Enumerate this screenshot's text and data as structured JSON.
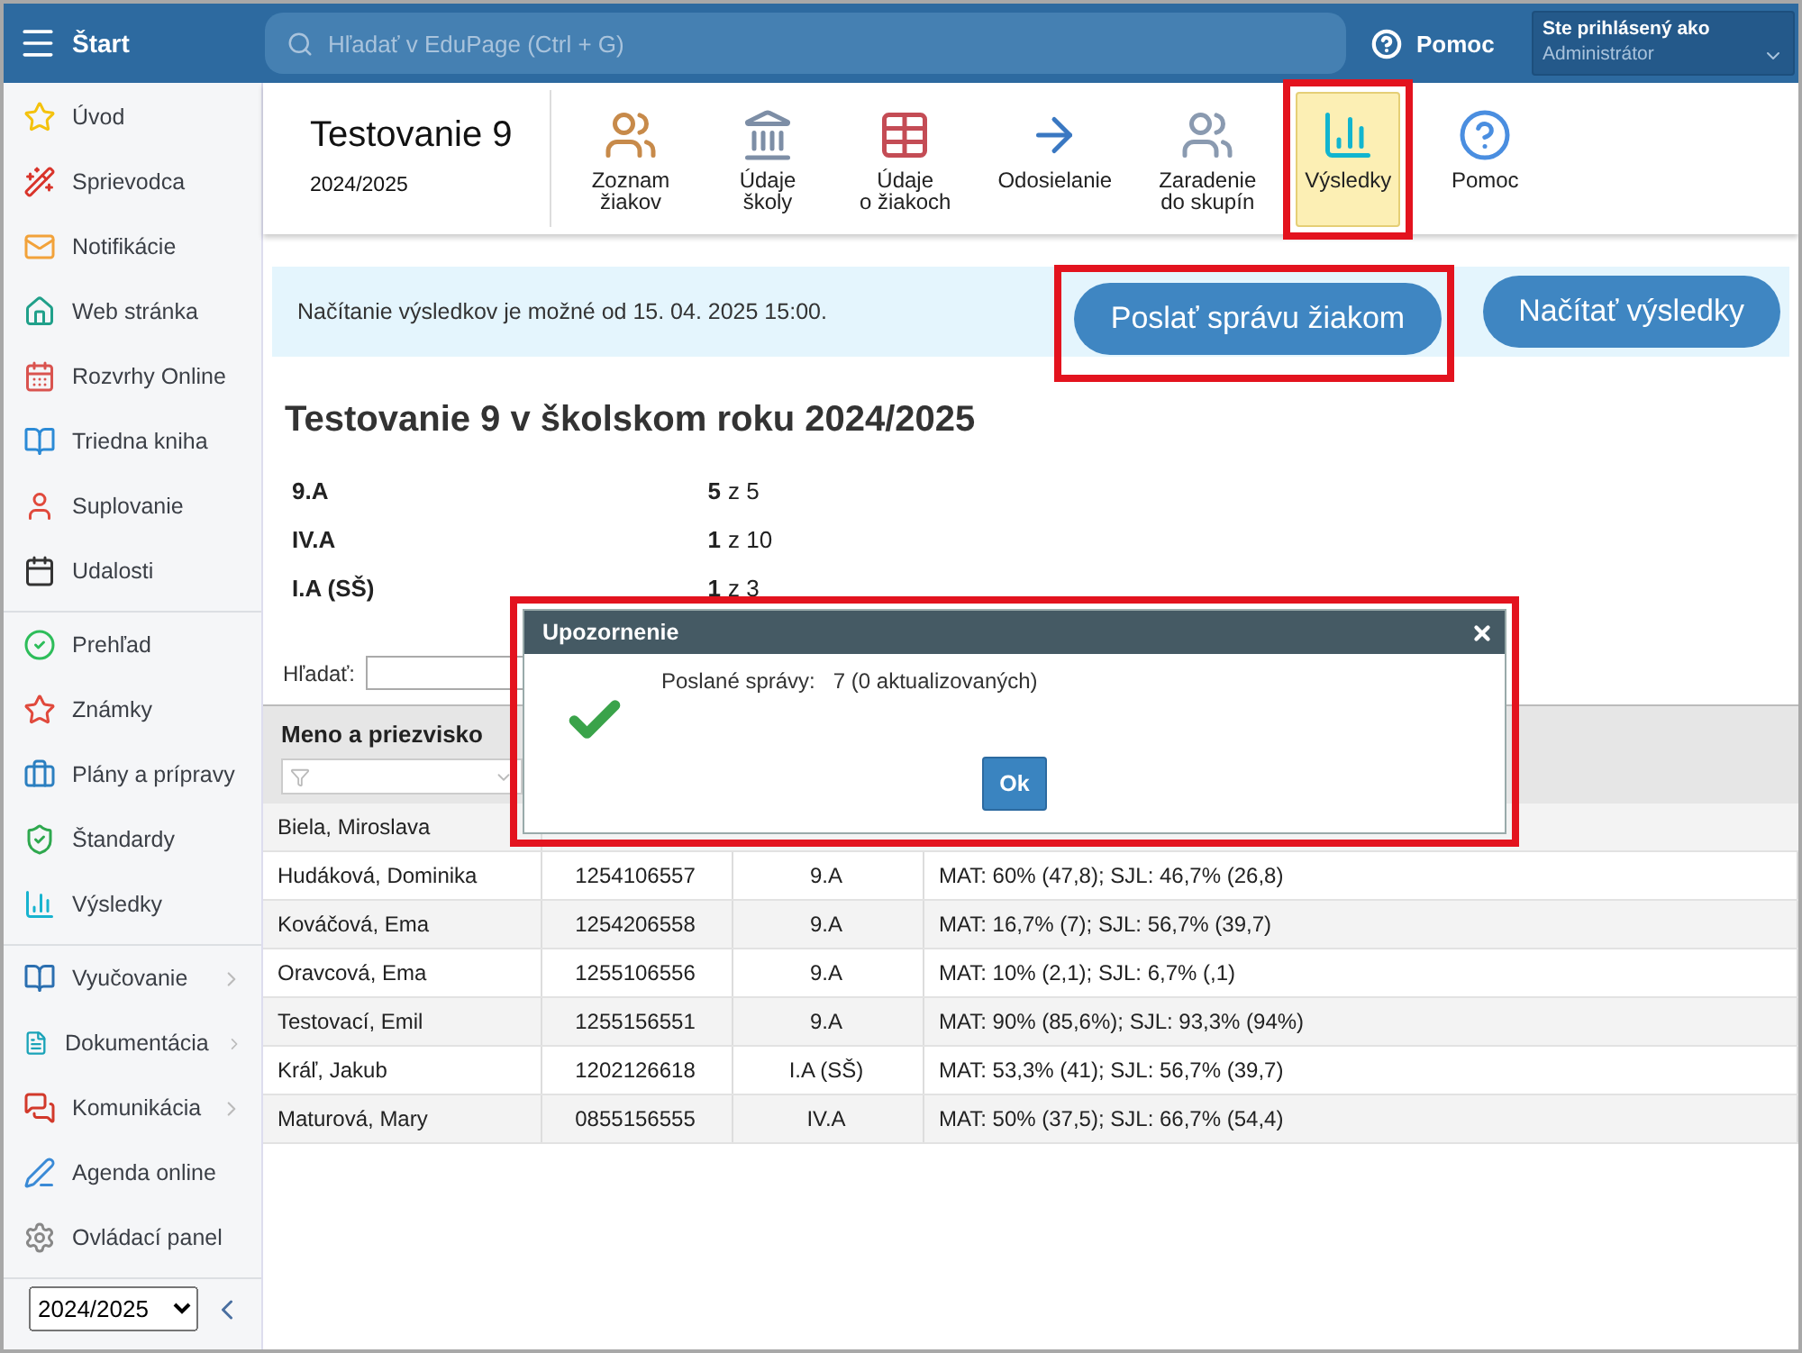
{
  "top_bar": {
    "menu_label": "Štart",
    "search": {
      "placeholder": "Hľadať v EduPage (Ctrl + G)"
    },
    "help": "Pomoc",
    "user": {
      "caption": "Ste prihlásený ako",
      "role": "Administrátor"
    }
  },
  "sidebar": {
    "groups": [
      [
        {
          "label": "Úvod",
          "kind": "star",
          "submenu": false
        },
        {
          "label": "Sprievodca",
          "kind": "wand",
          "submenu": false
        },
        {
          "label": "Notifikácie",
          "kind": "mail",
          "submenu": false
        },
        {
          "label": "Web stránka",
          "kind": "home",
          "submenu": false
        },
        {
          "label": "Rozvrhy Online",
          "kind": "grid",
          "submenu": false
        },
        {
          "label": "Triedna kniha",
          "kind": "book",
          "submenu": false
        },
        {
          "label": "Suplovanie",
          "kind": "person",
          "submenu": false
        },
        {
          "label": "Udalosti",
          "kind": "calendar",
          "submenu": false
        }
      ],
      [
        {
          "label": "Prehľad",
          "kind": "check",
          "submenu": false
        },
        {
          "label": "Známky",
          "kind": "grade",
          "submenu": false
        },
        {
          "label": "Plány a prípravy",
          "kind": "briefcase",
          "submenu": false
        },
        {
          "label": "Štandardy",
          "kind": "shield",
          "submenu": false
        },
        {
          "label": "Výsledky",
          "kind": "bars",
          "submenu": false
        }
      ],
      [
        {
          "label": "Vyučovanie",
          "kind": "openbook",
          "submenu": true
        },
        {
          "label": "Dokumentácia",
          "kind": "document",
          "submenu": true
        },
        {
          "label": "Komunikácia",
          "kind": "chat",
          "submenu": true
        },
        {
          "label": "Agenda online",
          "kind": "pen",
          "submenu": false
        },
        {
          "label": "Ovládací panel",
          "kind": "gear",
          "submenu": false
        }
      ]
    ],
    "year_select": "2024/2025"
  },
  "header": {
    "title": "Testovanie 9",
    "year": "2024/2025"
  },
  "tools": [
    {
      "label": "Zoznam\nžiakov",
      "kind": "students",
      "selected": false,
      "highlighted": false
    },
    {
      "label": "Údaje\nškoly",
      "kind": "school",
      "selected": false,
      "highlighted": false
    },
    {
      "label": "Údaje\no žiakoch",
      "kind": "table",
      "selected": false,
      "highlighted": false
    },
    {
      "label": "Odosielanie",
      "kind": "send",
      "selected": false,
      "highlighted": false
    },
    {
      "label": "Zaradenie\ndo skupín",
      "kind": "groups",
      "selected": false,
      "highlighted": false
    },
    {
      "label": "Výsledky",
      "kind": "bars",
      "selected": true,
      "highlighted": true
    },
    {
      "label": "Pomoc",
      "kind": "help",
      "selected": false,
      "highlighted": false
    }
  ],
  "info_bar": {
    "message": "Načítanie výsledkov je možné od 15. 04. 2025 15:00.",
    "buttons": [
      {
        "label": "Poslať správu žiakom",
        "highlighted": true
      },
      {
        "label": "Načítať výsledky",
        "highlighted": false
      }
    ]
  },
  "summary": {
    "title": "Testovanie 9 v školskom roku 2024/2025",
    "classes": [
      {
        "name": "9.A",
        "count": "5",
        "of": "z 5"
      },
      {
        "name": "IV.A",
        "count": "1",
        "of": "z 10"
      },
      {
        "name": "I.A (SŠ)",
        "count": "1",
        "of": "z 3"
      }
    ]
  },
  "search": {
    "label": "Hľadať:"
  },
  "table": {
    "columns": [
      {
        "label": "Meno a priezvisko",
        "filter": true
      }
    ],
    "rows": [
      [
        "Biela, Miroslava"
      ],
      [
        "Hudáková, Dominika",
        "1254106557",
        "9.A",
        "MAT: 60% (47,8); SJL: 46,7% (26,8)"
      ],
      [
        "Kováčová, Ema",
        "1254206558",
        "9.A",
        "MAT: 16,7% (7); SJL: 56,7% (39,7)"
      ],
      [
        "Oravcová, Ema",
        "1255106556",
        "9.A",
        "MAT: 10% (2,1); SJL: 6,7% (,1)"
      ],
      [
        "Testovací, Emil",
        "1255156551",
        "9.A",
        "MAT: 90% (85,6%); SJL: 93,3% (94%)"
      ],
      [
        "Kráľ, Jakub",
        "1202126618",
        "I.A (SŠ)",
        "MAT: 53,3% (41); SJL: 56,7% (39,7)"
      ],
      [
        "Maturová, Mary",
        "0855156555",
        "IV.A",
        "MAT: 50% (37,5); SJL: 66,7% (54,4)"
      ]
    ]
  },
  "dialog": {
    "title": "Upozornenie",
    "label": "Poslané správy:",
    "value": "7",
    "note": "(0 aktualizovaných)",
    "button": "Ok",
    "success": true,
    "highlighted": true
  }
}
